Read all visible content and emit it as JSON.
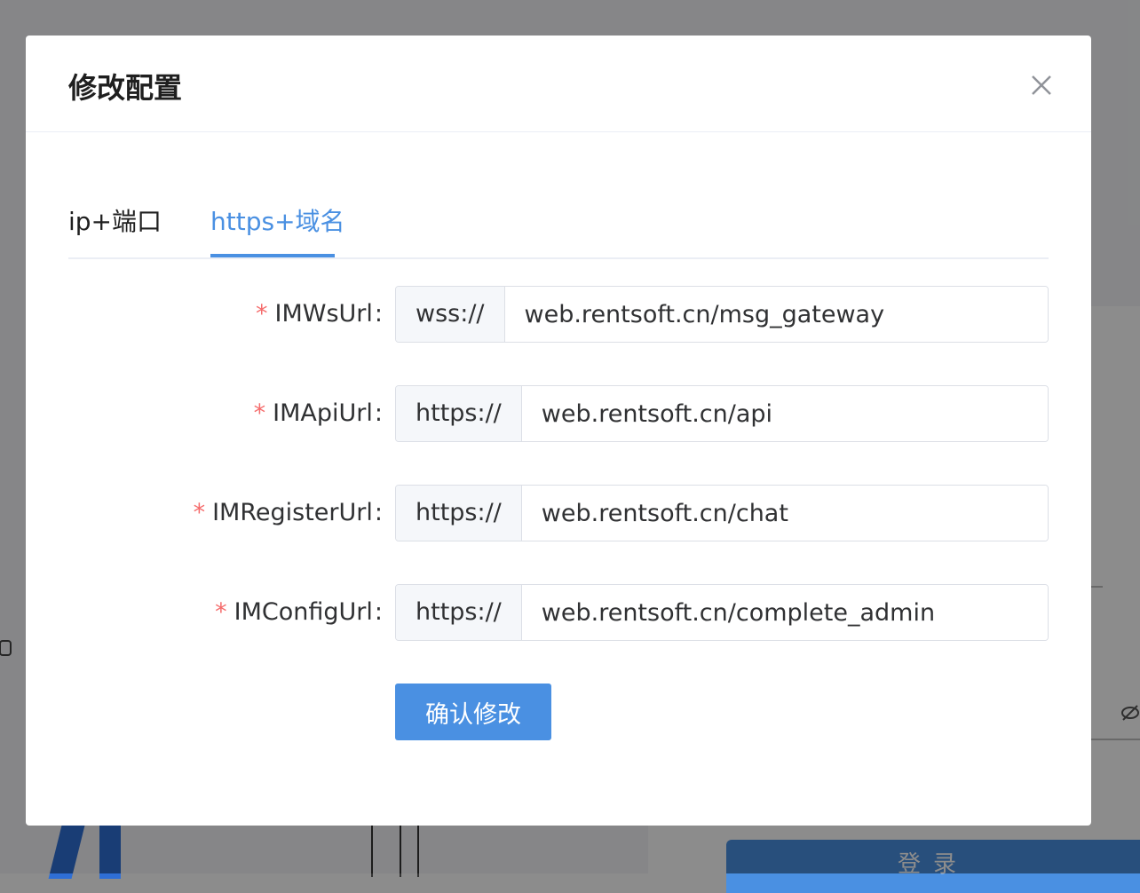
{
  "dialog": {
    "title": "修改配置",
    "tabs": [
      {
        "label": "ip+端口",
        "active": false
      },
      {
        "label": "https+域名",
        "active": true
      }
    ],
    "fields": [
      {
        "label": "IMWsUrl",
        "required": true,
        "prefix": "wss://",
        "value": "web.rentsoft.cn/msg_gateway"
      },
      {
        "label": "IMApiUrl",
        "required": true,
        "prefix": "https://",
        "value": "web.rentsoft.cn/api"
      },
      {
        "label": "IMRegisterUrl",
        "required": true,
        "prefix": "https://",
        "value": "web.rentsoft.cn/chat"
      },
      {
        "label": "IMConfigUrl",
        "required": true,
        "prefix": "https://",
        "value": "web.rentsoft.cn/complete_admin"
      }
    ],
    "required_mark": "*",
    "label_colon": ":",
    "confirm_label": "确认修改",
    "close_icon": "close-icon"
  },
  "background": {
    "login_button_label": "登录",
    "eye_icon": "eye-off-icon"
  },
  "colors": {
    "accent": "#4a90e2",
    "required": "#f56c6c",
    "overlay": "rgba(0,0,0,0.45)"
  }
}
